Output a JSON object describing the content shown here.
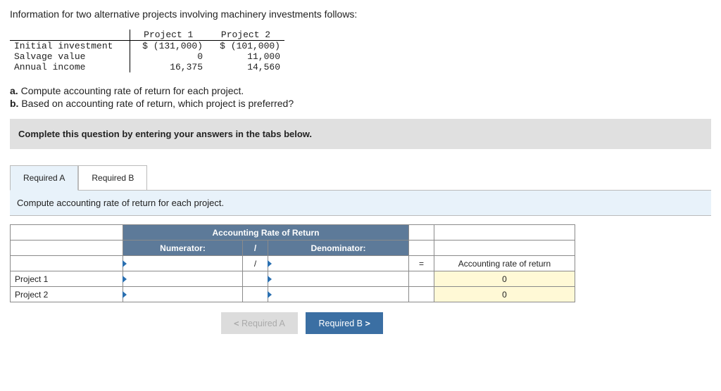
{
  "intro": "Information for two alternative projects involving machinery investments follows:",
  "datatable": {
    "col1": "Project 1",
    "col2": "Project 2",
    "rows": [
      {
        "label": "Initial investment",
        "p1": "$ (131,000)",
        "p2": "$ (101,000)"
      },
      {
        "label": "Salvage value",
        "p1": "0",
        "p2": "11,000"
      },
      {
        "label": "Annual income",
        "p1": "16,375",
        "p2": "14,560"
      }
    ]
  },
  "questions": {
    "a": "Compute accounting rate of return for each project.",
    "b": "Based on accounting rate of return, which project is preferred?"
  },
  "instruction": "Complete this question by entering your answers in the tabs below.",
  "tabs": {
    "a": "Required A",
    "b": "Required B"
  },
  "sub_instruction": "Compute accounting rate of return for each project.",
  "answer_table": {
    "title": "Accounting Rate of Return",
    "num_header": "Numerator:",
    "slash1": "/",
    "denom_header": "Denominator:",
    "slash2": "/",
    "eq": "=",
    "result_header": "Accounting rate of return",
    "rows": [
      {
        "label": "Project 1",
        "result": "0"
      },
      {
        "label": "Project 2",
        "result": "0"
      }
    ]
  },
  "nav": {
    "prev": "Required A",
    "next": "Required B"
  }
}
